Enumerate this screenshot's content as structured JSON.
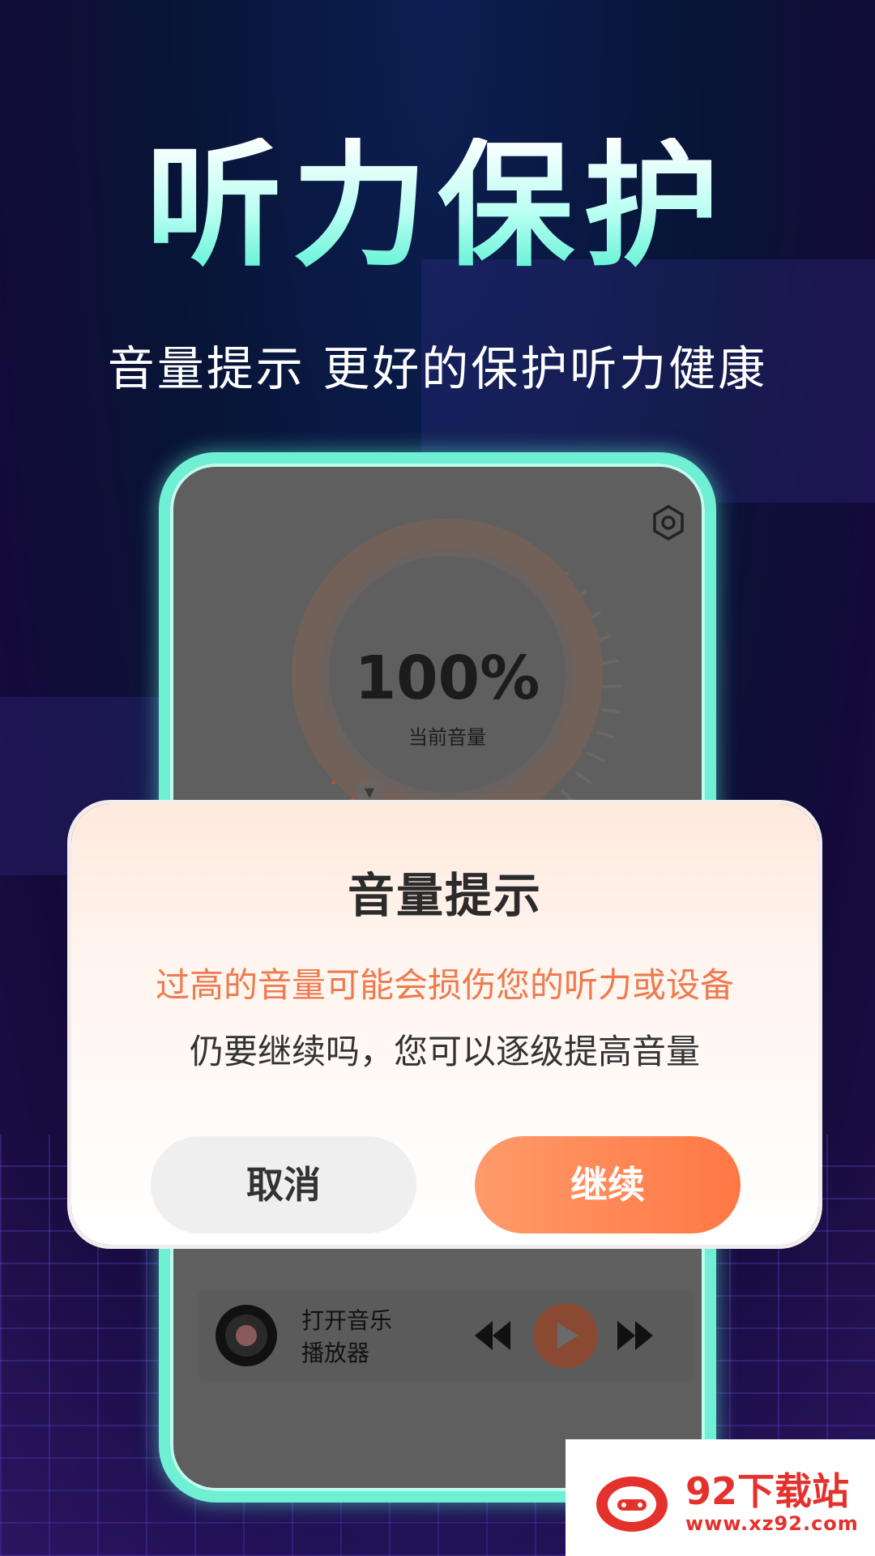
{
  "hero": {
    "title": "听力保护",
    "subtitle": "音量提示  更好的保护听力健康"
  },
  "phone": {
    "volume": {
      "value_text": "100%",
      "label": "当前音量",
      "level_percent": 100
    },
    "player": {
      "title_line1": "打开音乐",
      "title_line2": "播放器"
    }
  },
  "dialog": {
    "title": "音量提示",
    "warning": "过高的音量可能会损伤您的听力或设备",
    "message": "仍要继续吗，您可以逐级提高音量",
    "cancel_label": "取消",
    "continue_label": "继续"
  },
  "watermark": {
    "name": "92下载站",
    "url": "www.xz92.com"
  },
  "colors": {
    "accent_teal": "#6fefd4",
    "accent_orange": "#ff7844",
    "warning_text": "#ee7a4e",
    "brand_red": "#e5312c"
  },
  "icons": [
    "gear-icon",
    "disc-icon",
    "prev-icon",
    "play-icon",
    "next-icon",
    "wm-logo-icon"
  ]
}
